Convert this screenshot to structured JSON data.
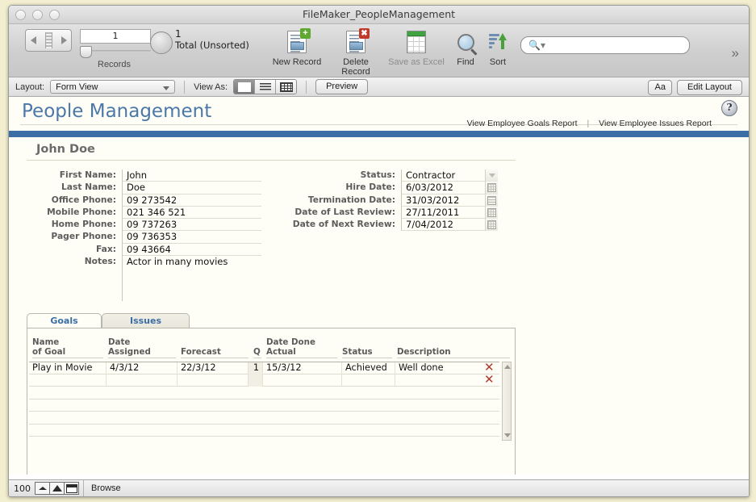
{
  "window": {
    "title": "FileMaker_PeopleManagement"
  },
  "toolbar": {
    "record_number": "1",
    "records_label": "Records",
    "total_count": "1",
    "total_label": "Total (Unsorted)",
    "buttons": [
      {
        "name": "new-record",
        "label": "New Record",
        "icon": "record-plus-icon"
      },
      {
        "name": "delete-record",
        "label": "Delete Record",
        "icon": "record-delete-icon"
      },
      {
        "name": "save-as-excel",
        "label": "Save as Excel",
        "icon": "excel-sheet-icon"
      },
      {
        "name": "find",
        "label": "Find",
        "icon": "magnifier-icon"
      },
      {
        "name": "sort",
        "label": "Sort",
        "icon": "sort-ascending-icon"
      }
    ],
    "search_placeholder": "",
    "overflow_label": "»"
  },
  "layoutbar": {
    "layout_label": "Layout:",
    "layout_value": "Form View",
    "view_as_label": "View As:",
    "view_modes": [
      "form-view",
      "list-view",
      "table-view"
    ],
    "active_view": "form-view",
    "preview_label": "Preview",
    "text_format_label": "Aa",
    "edit_layout_label": "Edit Layout"
  },
  "page": {
    "title": "People Management",
    "help_label": "?",
    "report_links": [
      "View Employee Goals Report",
      "View Employee Issues Report"
    ],
    "link_separator": "|",
    "accent_color": "#3b6ea5",
    "person_name": "John Doe",
    "watermark": ""
  },
  "form": {
    "left": [
      {
        "label": "First Name:",
        "value": "John"
      },
      {
        "label": "Last Name:",
        "value": "Doe"
      },
      {
        "label": "Office Phone:",
        "value": "09 273542"
      },
      {
        "label": "Mobile Phone:",
        "value": "021 346 521"
      },
      {
        "label": "Home Phone:",
        "value": "09 737263"
      },
      {
        "label": "Pager Phone:",
        "value": "09 736353"
      },
      {
        "label": "Fax:",
        "value": "09 43664"
      }
    ],
    "notes": {
      "label": "Notes:",
      "value": "Actor in many movies"
    },
    "right": [
      {
        "label": "Status:",
        "value": "Contractor",
        "control": "dropdown-arrow-icon"
      },
      {
        "label": "Hire Date:",
        "value": "6/03/2012",
        "control": "calendar-icon"
      },
      {
        "label": "Termination Date:",
        "value": "31/03/2012",
        "control": "calendar-lines-icon"
      },
      {
        "label": "Date of Last Review:",
        "value": "27/11/2011",
        "control": "calendar-icon"
      },
      {
        "label": "Date of Next Review:",
        "value": "7/04/2012",
        "control": "calendar-icon"
      }
    ]
  },
  "tabs": [
    {
      "label": "Goals",
      "active": true
    },
    {
      "label": "Issues",
      "active": false
    }
  ],
  "portal": {
    "columns": [
      {
        "line1": "Name",
        "line2": "of Goal"
      },
      {
        "line1": "Date",
        "line2": "Assigned"
      },
      {
        "line1": "",
        "line2": "Forecast"
      },
      {
        "line1": "",
        "line2": "Q"
      },
      {
        "line1": "Date Done",
        "line2": "Actual"
      },
      {
        "line1": "",
        "line2": "Status"
      },
      {
        "line1": "",
        "line2": "Description"
      }
    ],
    "rows": [
      {
        "name_of_goal": "Play in Movie",
        "date_assigned": "4/3/12",
        "forecast": "22/3/12",
        "q": "1",
        "date_done_actual": "15/3/12",
        "status": "Achieved",
        "description": "Well done",
        "delete_label": "✕"
      },
      {
        "name_of_goal": "",
        "date_assigned": "",
        "forecast": "",
        "q": "",
        "date_done_actual": "",
        "status": "",
        "description": "",
        "delete_label": "✕"
      }
    ],
    "empty_row_count": 5
  },
  "statusbar": {
    "zoom_level": "100",
    "mode": "Browse"
  }
}
